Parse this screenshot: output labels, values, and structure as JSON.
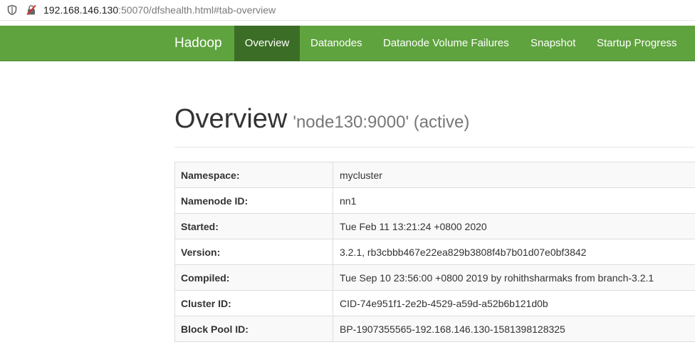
{
  "browser": {
    "url_host": "192.168.146.130",
    "url_rest": ":50070/dfshealth.html#tab-overview",
    "icons": [
      "shield-icon",
      "not-secure-icon"
    ]
  },
  "navbar": {
    "brand": "Hadoop",
    "bg_color": "#5fa33e",
    "active_bg_color": "#3c6d26",
    "items": [
      {
        "label": "Overview",
        "active": true
      },
      {
        "label": "Datanodes",
        "active": false
      },
      {
        "label": "Datanode Volume Failures",
        "active": false
      },
      {
        "label": "Snapshot",
        "active": false
      },
      {
        "label": "Startup Progress",
        "active": false
      }
    ]
  },
  "page": {
    "title": "Overview",
    "subtitle": "'node130:9000' (active)"
  },
  "overview_table": [
    {
      "key": "Namespace:",
      "value": "mycluster"
    },
    {
      "key": "Namenode ID:",
      "value": "nn1"
    },
    {
      "key": "Started:",
      "value": "Tue Feb 11 13:21:24 +0800 2020"
    },
    {
      "key": "Version:",
      "value": "3.2.1, rb3cbbb467e22ea829b3808f4b7b01d07e0bf3842"
    },
    {
      "key": "Compiled:",
      "value": "Tue Sep 10 23:56:00 +0800 2019 by rohithsharmaks from branch-3.2.1"
    },
    {
      "key": "Cluster ID:",
      "value": "CID-74e951f1-2e2b-4529-a59d-a52b6b121d0b"
    },
    {
      "key": "Block Pool ID:",
      "value": "BP-1907355565-192.168.146.130-1581398128325"
    }
  ]
}
